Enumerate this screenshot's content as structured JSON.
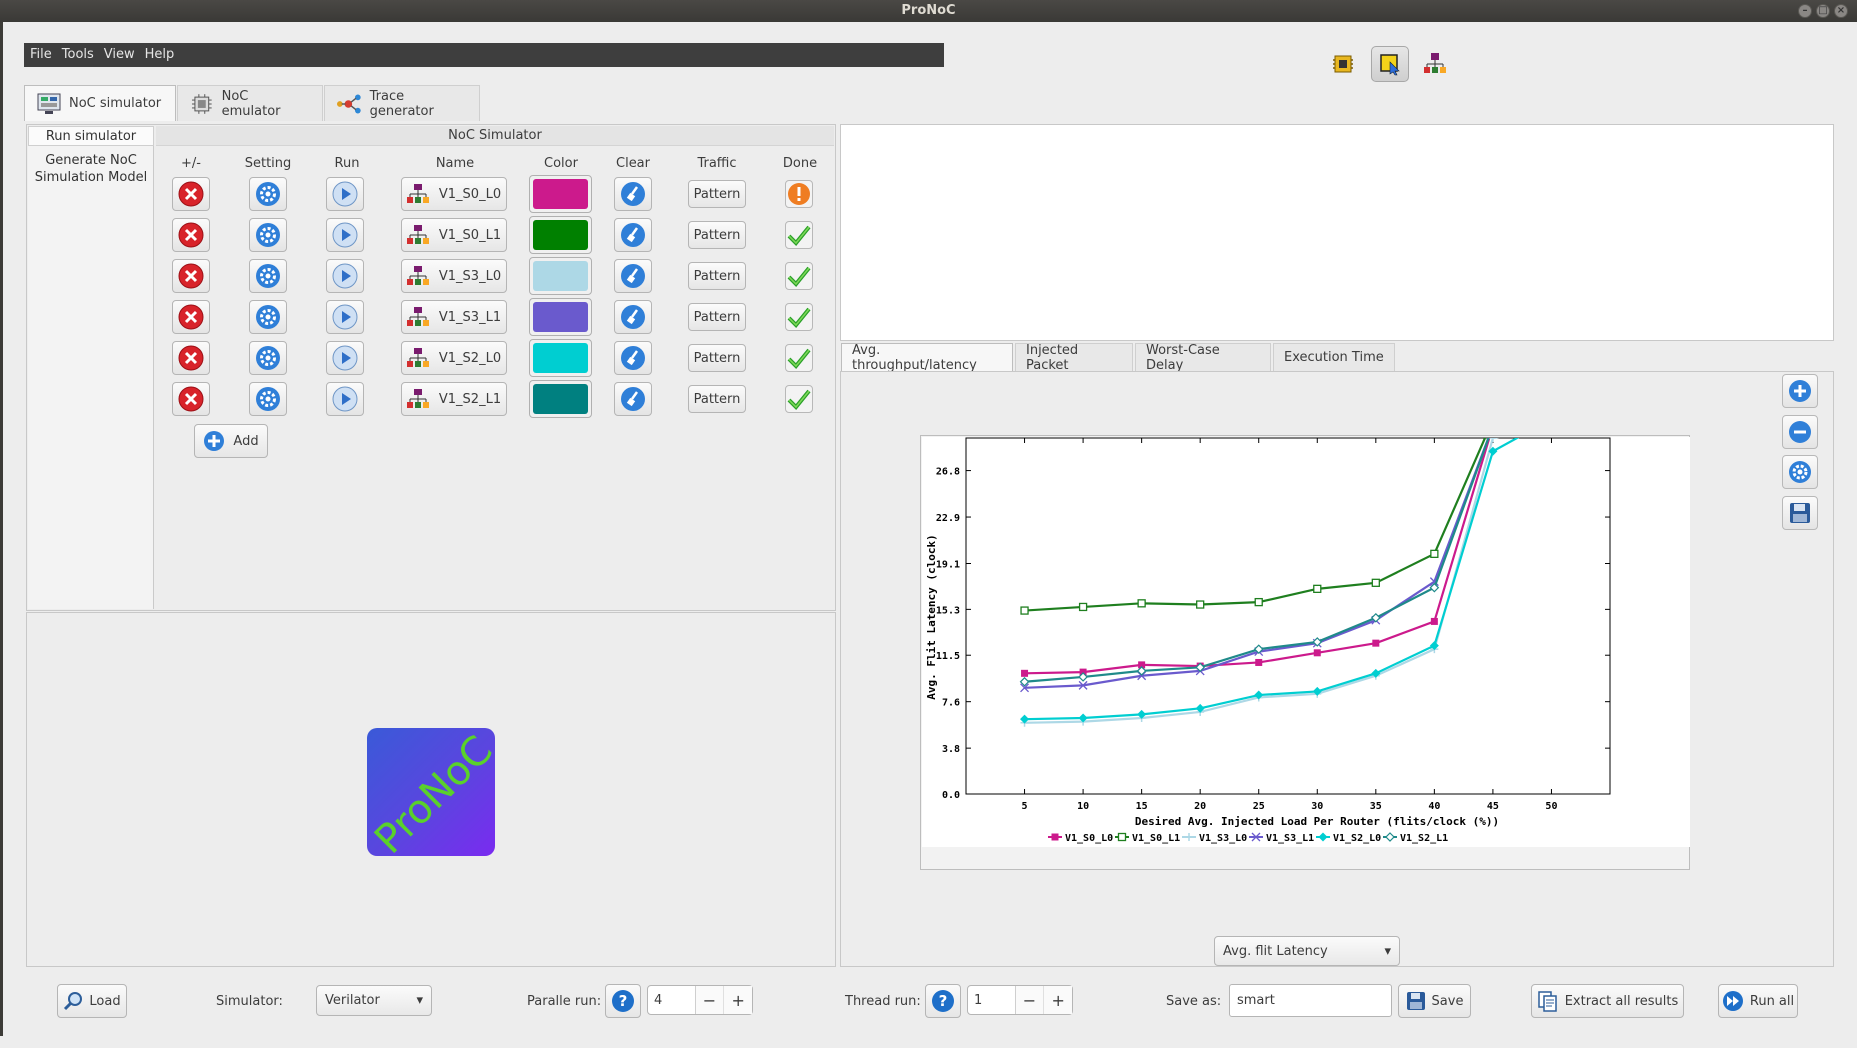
{
  "window": {
    "title": "ProNoC"
  },
  "menu": [
    "File",
    "Tools",
    "View",
    "Help"
  ],
  "tabs": [
    {
      "label": "NoC simulator"
    },
    {
      "label": "NoC emulator"
    },
    {
      "label": "Trace generator"
    }
  ],
  "sidebar": {
    "items": [
      "Run simulator",
      "Generate NoC Simulation Model"
    ]
  },
  "simulator_panel": {
    "title": "NoC Simulator",
    "columns": [
      "+/-",
      "Setting",
      "Run",
      "Name",
      "Color",
      "Clear",
      "Traffic",
      "Done"
    ],
    "rows": [
      {
        "name": "V1_S0_L0",
        "color": "#cc1a8c",
        "traffic": "Pattern",
        "done": "warning"
      },
      {
        "name": "V1_S0_L1",
        "color": "#008000",
        "traffic": "Pattern",
        "done": "ok"
      },
      {
        "name": "V1_S3_L0",
        "color": "#add8e6",
        "traffic": "Pattern",
        "done": "ok"
      },
      {
        "name": "V1_S3_L1",
        "color": "#6a5acd",
        "traffic": "Pattern",
        "done": "ok"
      },
      {
        "name": "V1_S2_L0",
        "color": "#00ced1",
        "traffic": "Pattern",
        "done": "ok"
      },
      {
        "name": "V1_S2_L1",
        "color": "#008080",
        "traffic": "Pattern",
        "done": "ok"
      }
    ],
    "add_label": "Add"
  },
  "logo_text": "ProNoC",
  "result_tabs": [
    "Avg. throughput/latency",
    "Injected Packet",
    "Worst-Case Delay",
    "Execution Time"
  ],
  "metric_select": "Avg. flit Latency",
  "bottom": {
    "load_label": "Load",
    "simulator_label": "Simulator:",
    "simulator_value": "Verilator",
    "parallel_label": "Paralle run:",
    "parallel_value": "4",
    "thread_label": "Thread run:",
    "thread_value": "1",
    "save_as_label": "Save as:",
    "save_as_value": "smart",
    "save_label": "Save",
    "extract_label": "Extract all results",
    "run_all_label": "Run all"
  },
  "chart_data": {
    "type": "line",
    "xlabel": "Desired Avg. Injected Load Per Router (flits/clock (%))",
    "ylabel": "Avg. Flit Latency (clock)",
    "x_ticks": [
      5,
      10,
      15,
      20,
      25,
      30,
      35,
      40,
      45,
      50
    ],
    "y_ticks": [
      "0.0",
      "3.8",
      "7.6",
      "11.5",
      "15.3",
      "19.1",
      "22.9",
      "26.8"
    ],
    "xlim": [
      0,
      55
    ],
    "ylim": [
      0,
      29.5
    ],
    "legend_position": "bottom",
    "series": [
      {
        "name": "V1_S0_L0",
        "color": "#cc1a8c",
        "marker": "square-filled",
        "x": [
          5,
          10,
          15,
          20,
          25,
          30,
          35,
          40,
          45
        ],
        "y": [
          10.0,
          10.1,
          10.7,
          10.6,
          10.9,
          11.7,
          12.5,
          14.3,
          30.5
        ]
      },
      {
        "name": "V1_S0_L1",
        "color": "#1f7f1f",
        "marker": "square-open",
        "x": [
          5,
          10,
          15,
          20,
          25,
          30,
          35,
          40,
          45
        ],
        "y": [
          15.2,
          15.5,
          15.8,
          15.7,
          15.9,
          17.0,
          17.5,
          19.9,
          31.0
        ]
      },
      {
        "name": "V1_S3_L0",
        "color": "#add8e6",
        "marker": "plus",
        "x": [
          5,
          10,
          15,
          20,
          25,
          30,
          35,
          40,
          45,
          48
        ],
        "y": [
          5.9,
          6.0,
          6.3,
          6.8,
          8.0,
          8.3,
          9.8,
          12.0,
          29.5,
          30.0
        ]
      },
      {
        "name": "V1_S3_L1",
        "color": "#6a5acd",
        "marker": "x",
        "x": [
          5,
          10,
          15,
          20,
          25,
          30,
          35,
          40,
          45
        ],
        "y": [
          8.8,
          9.0,
          9.8,
          10.2,
          11.8,
          12.5,
          14.4,
          17.6,
          30.5
        ]
      },
      {
        "name": "V1_S2_L0",
        "color": "#00ced1",
        "marker": "diamond-filled",
        "x": [
          5,
          10,
          15,
          20,
          25,
          30,
          35,
          40,
          45,
          48
        ],
        "y": [
          6.2,
          6.3,
          6.6,
          7.1,
          8.2,
          8.5,
          10.0,
          12.3,
          28.4,
          30.0
        ]
      },
      {
        "name": "V1_S2_L1",
        "color": "#1f8a8a",
        "marker": "diamond-open",
        "x": [
          5,
          10,
          15,
          20,
          25,
          30,
          35,
          40,
          45
        ],
        "y": [
          9.3,
          9.7,
          10.2,
          10.5,
          12.0,
          12.6,
          14.6,
          17.1,
          30.5
        ]
      }
    ]
  }
}
